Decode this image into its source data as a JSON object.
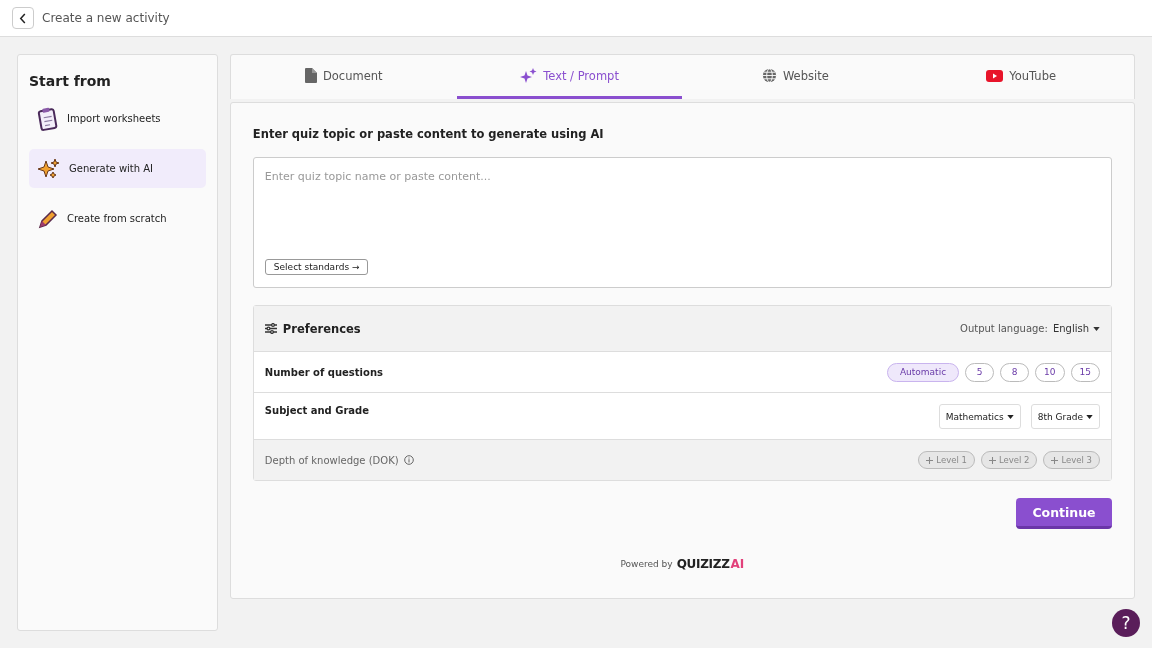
{
  "header": {
    "title": "Create a new activity"
  },
  "sidebar": {
    "title": "Start from",
    "items": [
      {
        "kind": "worksheet",
        "label": "Import worksheets",
        "selected": false
      },
      {
        "kind": "ai",
        "label": "Generate with AI",
        "selected": true
      },
      {
        "kind": "scratch",
        "label": "Create from scratch",
        "selected": false
      }
    ]
  },
  "tabs": [
    {
      "kind": "document",
      "label": "Document",
      "selected": false
    },
    {
      "kind": "prompt",
      "label": "Text / Prompt",
      "selected": true
    },
    {
      "kind": "website",
      "label": "Website",
      "selected": false
    },
    {
      "kind": "youtube",
      "label": "YouTube",
      "selected": false
    }
  ],
  "prompt": {
    "heading": "Enter quiz topic or paste content to generate using AI",
    "placeholder": "Enter quiz topic name or paste content...",
    "standards_button": "Select standards →"
  },
  "preferences": {
    "title": "Preferences",
    "language_label": "Output language:",
    "language": "English",
    "questions": {
      "label": "Number of questions",
      "options": [
        {
          "label": "Automatic",
          "selected": true
        },
        {
          "label": "5",
          "selected": false
        },
        {
          "label": "8",
          "selected": false
        },
        {
          "label": "10",
          "selected": false
        },
        {
          "label": "15",
          "selected": false
        }
      ]
    },
    "subject": {
      "label": "Subject and Grade",
      "dropdowns": [
        "Mathematics",
        "8th Grade"
      ]
    },
    "dok": {
      "label": "Depth of knowledge (DOK)",
      "levels": [
        {
          "label": "Level 1",
          "selected": false
        },
        {
          "label": "Level 2",
          "selected": false
        },
        {
          "label": "Level 3",
          "selected": false
        }
      ]
    }
  },
  "continue_button": "Continue",
  "powered_by": {
    "text": "Powered by",
    "brand": "QUIZIZZ",
    "brand_suffix": "AI"
  },
  "help_button": "?"
}
